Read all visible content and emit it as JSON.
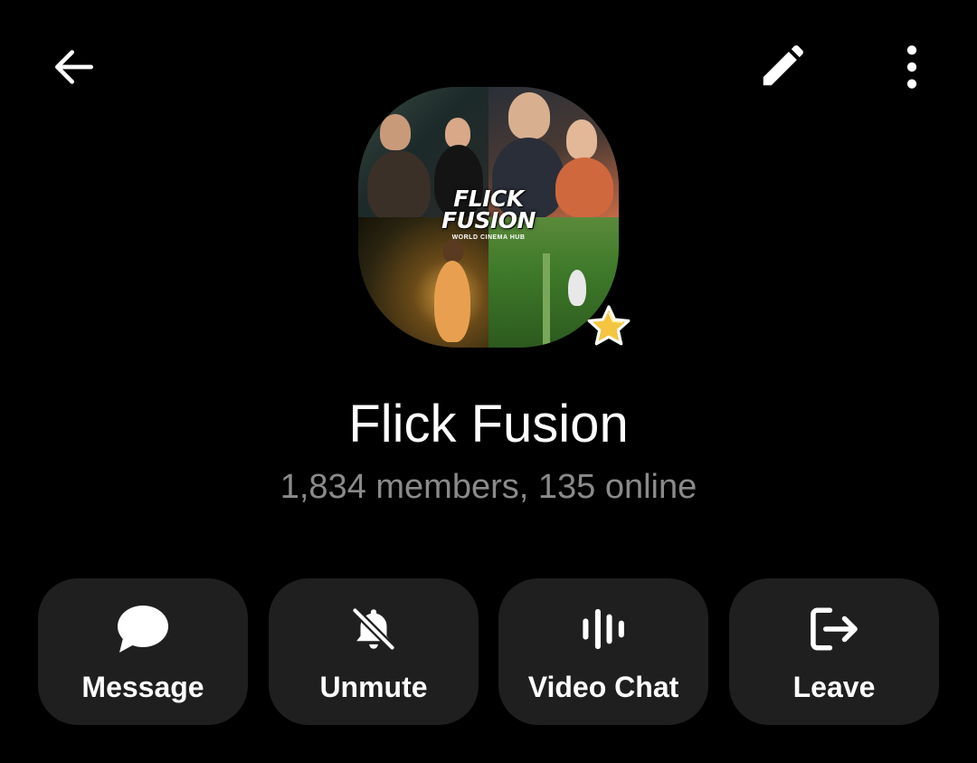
{
  "header": {
    "back_icon": "arrow-left-icon",
    "edit_icon": "pencil-icon",
    "more_icon": "more-vertical-icon"
  },
  "avatar": {
    "title_line1": "FLICK",
    "title_line2": "FUSION",
    "subtitle": "WORLD CINEMA HUB",
    "badge_icon": "star-icon",
    "badge_color": "#f5c542"
  },
  "group": {
    "name": "Flick Fusion",
    "status": "1,834 members, 135 online"
  },
  "actions": [
    {
      "label": "Message",
      "icon": "chat-bubble-icon"
    },
    {
      "label": "Unmute",
      "icon": "bell-off-icon"
    },
    {
      "label": "Video Chat",
      "icon": "voice-chat-icon"
    },
    {
      "label": "Leave",
      "icon": "leave-icon"
    }
  ],
  "colors": {
    "background": "#000000",
    "button_bg": "#1f1f1f",
    "subtitle": "#8a8a8a"
  }
}
